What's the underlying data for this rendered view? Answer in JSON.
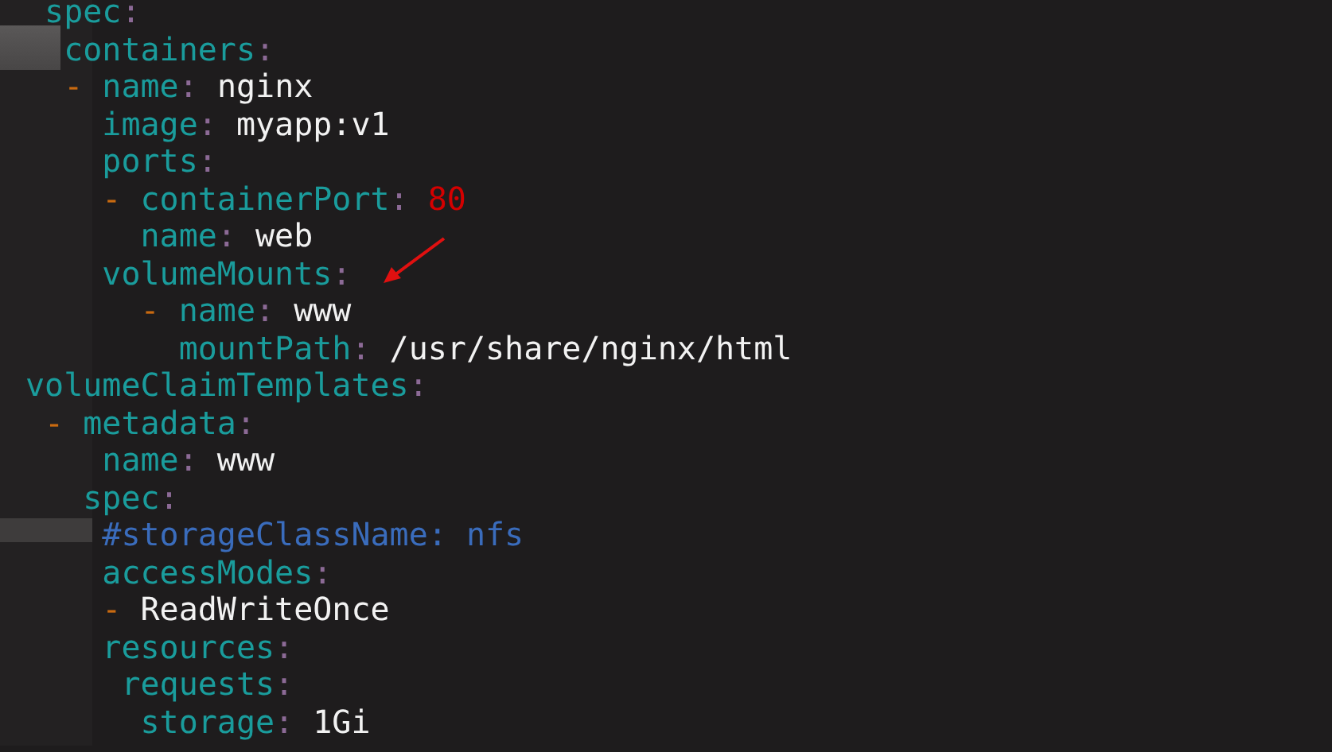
{
  "editor": {
    "lines": [
      {
        "tokens": [
          {
            "kind": "key",
            "text": " spec"
          },
          {
            "kind": "colon",
            "text": ":"
          }
        ]
      },
      {
        "tokens": [
          {
            "kind": "key",
            "text": "  containers"
          },
          {
            "kind": "colon",
            "text": ":"
          }
        ]
      },
      {
        "tokens": [
          {
            "kind": "dash",
            "text": "  -"
          },
          {
            "kind": "key",
            "text": " name"
          },
          {
            "kind": "colon",
            "text": ":"
          },
          {
            "kind": "value",
            "text": " nginx"
          }
        ]
      },
      {
        "tokens": [
          {
            "kind": "key",
            "text": "    image"
          },
          {
            "kind": "colon",
            "text": ":"
          },
          {
            "kind": "value",
            "text": " myapp:v1"
          }
        ]
      },
      {
        "tokens": [
          {
            "kind": "key",
            "text": "    ports"
          },
          {
            "kind": "colon",
            "text": ":"
          }
        ]
      },
      {
        "tokens": [
          {
            "kind": "dash",
            "text": "    -"
          },
          {
            "kind": "key",
            "text": " containerPort"
          },
          {
            "kind": "colon",
            "text": ":"
          },
          {
            "kind": "number",
            "text": " 80"
          }
        ]
      },
      {
        "tokens": [
          {
            "kind": "key",
            "text": "      name"
          },
          {
            "kind": "colon",
            "text": ":"
          },
          {
            "kind": "value",
            "text": " web"
          }
        ]
      },
      {
        "tokens": [
          {
            "kind": "key",
            "text": "    volumeMounts"
          },
          {
            "kind": "colon",
            "text": ":"
          }
        ]
      },
      {
        "tokens": [
          {
            "kind": "dash",
            "text": "      -"
          },
          {
            "kind": "key",
            "text": " name"
          },
          {
            "kind": "colon",
            "text": ":"
          },
          {
            "kind": "value",
            "text": " www"
          }
        ]
      },
      {
        "tokens": [
          {
            "kind": "key",
            "text": "        mountPath"
          },
          {
            "kind": "colon",
            "text": ":"
          },
          {
            "kind": "value",
            "text": " /usr/share/nginx/html"
          }
        ]
      },
      {
        "tokens": [
          {
            "kind": "key",
            "text": "volumeClaimTemplates"
          },
          {
            "kind": "colon",
            "text": ":"
          }
        ]
      },
      {
        "tokens": [
          {
            "kind": "dash",
            "text": " -"
          },
          {
            "kind": "key",
            "text": " metadata"
          },
          {
            "kind": "colon",
            "text": ":"
          }
        ]
      },
      {
        "tokens": [
          {
            "kind": "key",
            "text": "    name"
          },
          {
            "kind": "colon",
            "text": ":"
          },
          {
            "kind": "value",
            "text": " www"
          }
        ]
      },
      {
        "tokens": [
          {
            "kind": "key",
            "text": "   spec"
          },
          {
            "kind": "colon",
            "text": ":"
          }
        ]
      },
      {
        "tokens": [
          {
            "kind": "comment",
            "text": "    #storageClassName: nfs"
          }
        ]
      },
      {
        "tokens": [
          {
            "kind": "key",
            "text": "    accessModes"
          },
          {
            "kind": "colon",
            "text": ":"
          }
        ]
      },
      {
        "tokens": [
          {
            "kind": "dash",
            "text": "    -"
          },
          {
            "kind": "value",
            "text": " ReadWriteOnce"
          }
        ]
      },
      {
        "tokens": [
          {
            "kind": "key",
            "text": "    resources"
          },
          {
            "kind": "colon",
            "text": ":"
          }
        ]
      },
      {
        "tokens": [
          {
            "kind": "key",
            "text": "     requests"
          },
          {
            "kind": "colon",
            "text": ":"
          }
        ]
      },
      {
        "tokens": [
          {
            "kind": "key",
            "text": "      storage"
          },
          {
            "kind": "colon",
            "text": ":"
          },
          {
            "kind": "value",
            "text": " 1Gi"
          }
        ]
      }
    ]
  }
}
